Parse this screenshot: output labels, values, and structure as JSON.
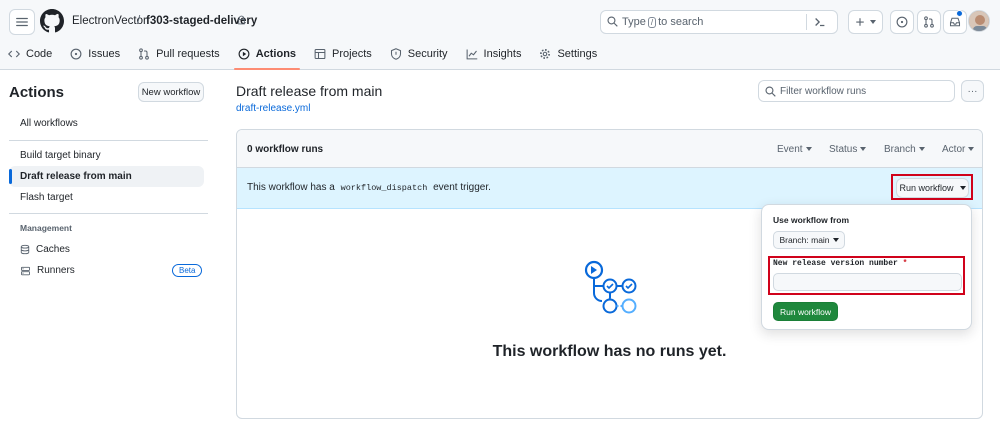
{
  "header": {
    "owner": "ElectronVector",
    "separator": "/",
    "repo": "f303-staged-delivery",
    "search_prefix": "Type",
    "search_key": "/",
    "search_suffix": "to search"
  },
  "nav": {
    "tabs": [
      {
        "label": "Code",
        "icon": "code-icon"
      },
      {
        "label": "Issues",
        "icon": "issue-icon"
      },
      {
        "label": "Pull requests",
        "icon": "pull-request-icon"
      },
      {
        "label": "Actions",
        "icon": "play-icon",
        "active": true
      },
      {
        "label": "Projects",
        "icon": "table-icon"
      },
      {
        "label": "Security",
        "icon": "shield-icon"
      },
      {
        "label": "Insights",
        "icon": "graph-icon"
      },
      {
        "label": "Settings",
        "icon": "gear-icon"
      }
    ]
  },
  "sidebar": {
    "title": "Actions",
    "new_workflow": "New workflow",
    "all_workflows": "All workflows",
    "workflows": [
      "Build target binary",
      "Draft release from main",
      "Flash target"
    ],
    "management_heading": "Management",
    "caches": "Caches",
    "runners": "Runners",
    "beta": "Beta"
  },
  "main": {
    "title": "Draft release from main",
    "file": "draft-release.yml",
    "filter_placeholder": "Filter workflow runs",
    "more": "···",
    "runs_count": "0 workflow runs",
    "filters": [
      "Event",
      "Status",
      "Branch",
      "Actor"
    ],
    "banner_pre": "This workflow has a",
    "banner_code": "workflow_dispatch",
    "banner_post": "event trigger.",
    "run_workflow": "Run workflow",
    "empty": "This workflow has no runs yet."
  },
  "dropdown": {
    "title": "Use workflow from",
    "branch": "Branch: main",
    "input_label": "New release version number",
    "required_mark": "*",
    "input_value": "",
    "submit": "Run workflow"
  },
  "colors": {
    "accent": "#0969da",
    "nav_underline": "#fd8c73",
    "banner_bg": "#ddf4ff",
    "primary_button": "#1f883d",
    "highlight_box": "#d0021b"
  }
}
